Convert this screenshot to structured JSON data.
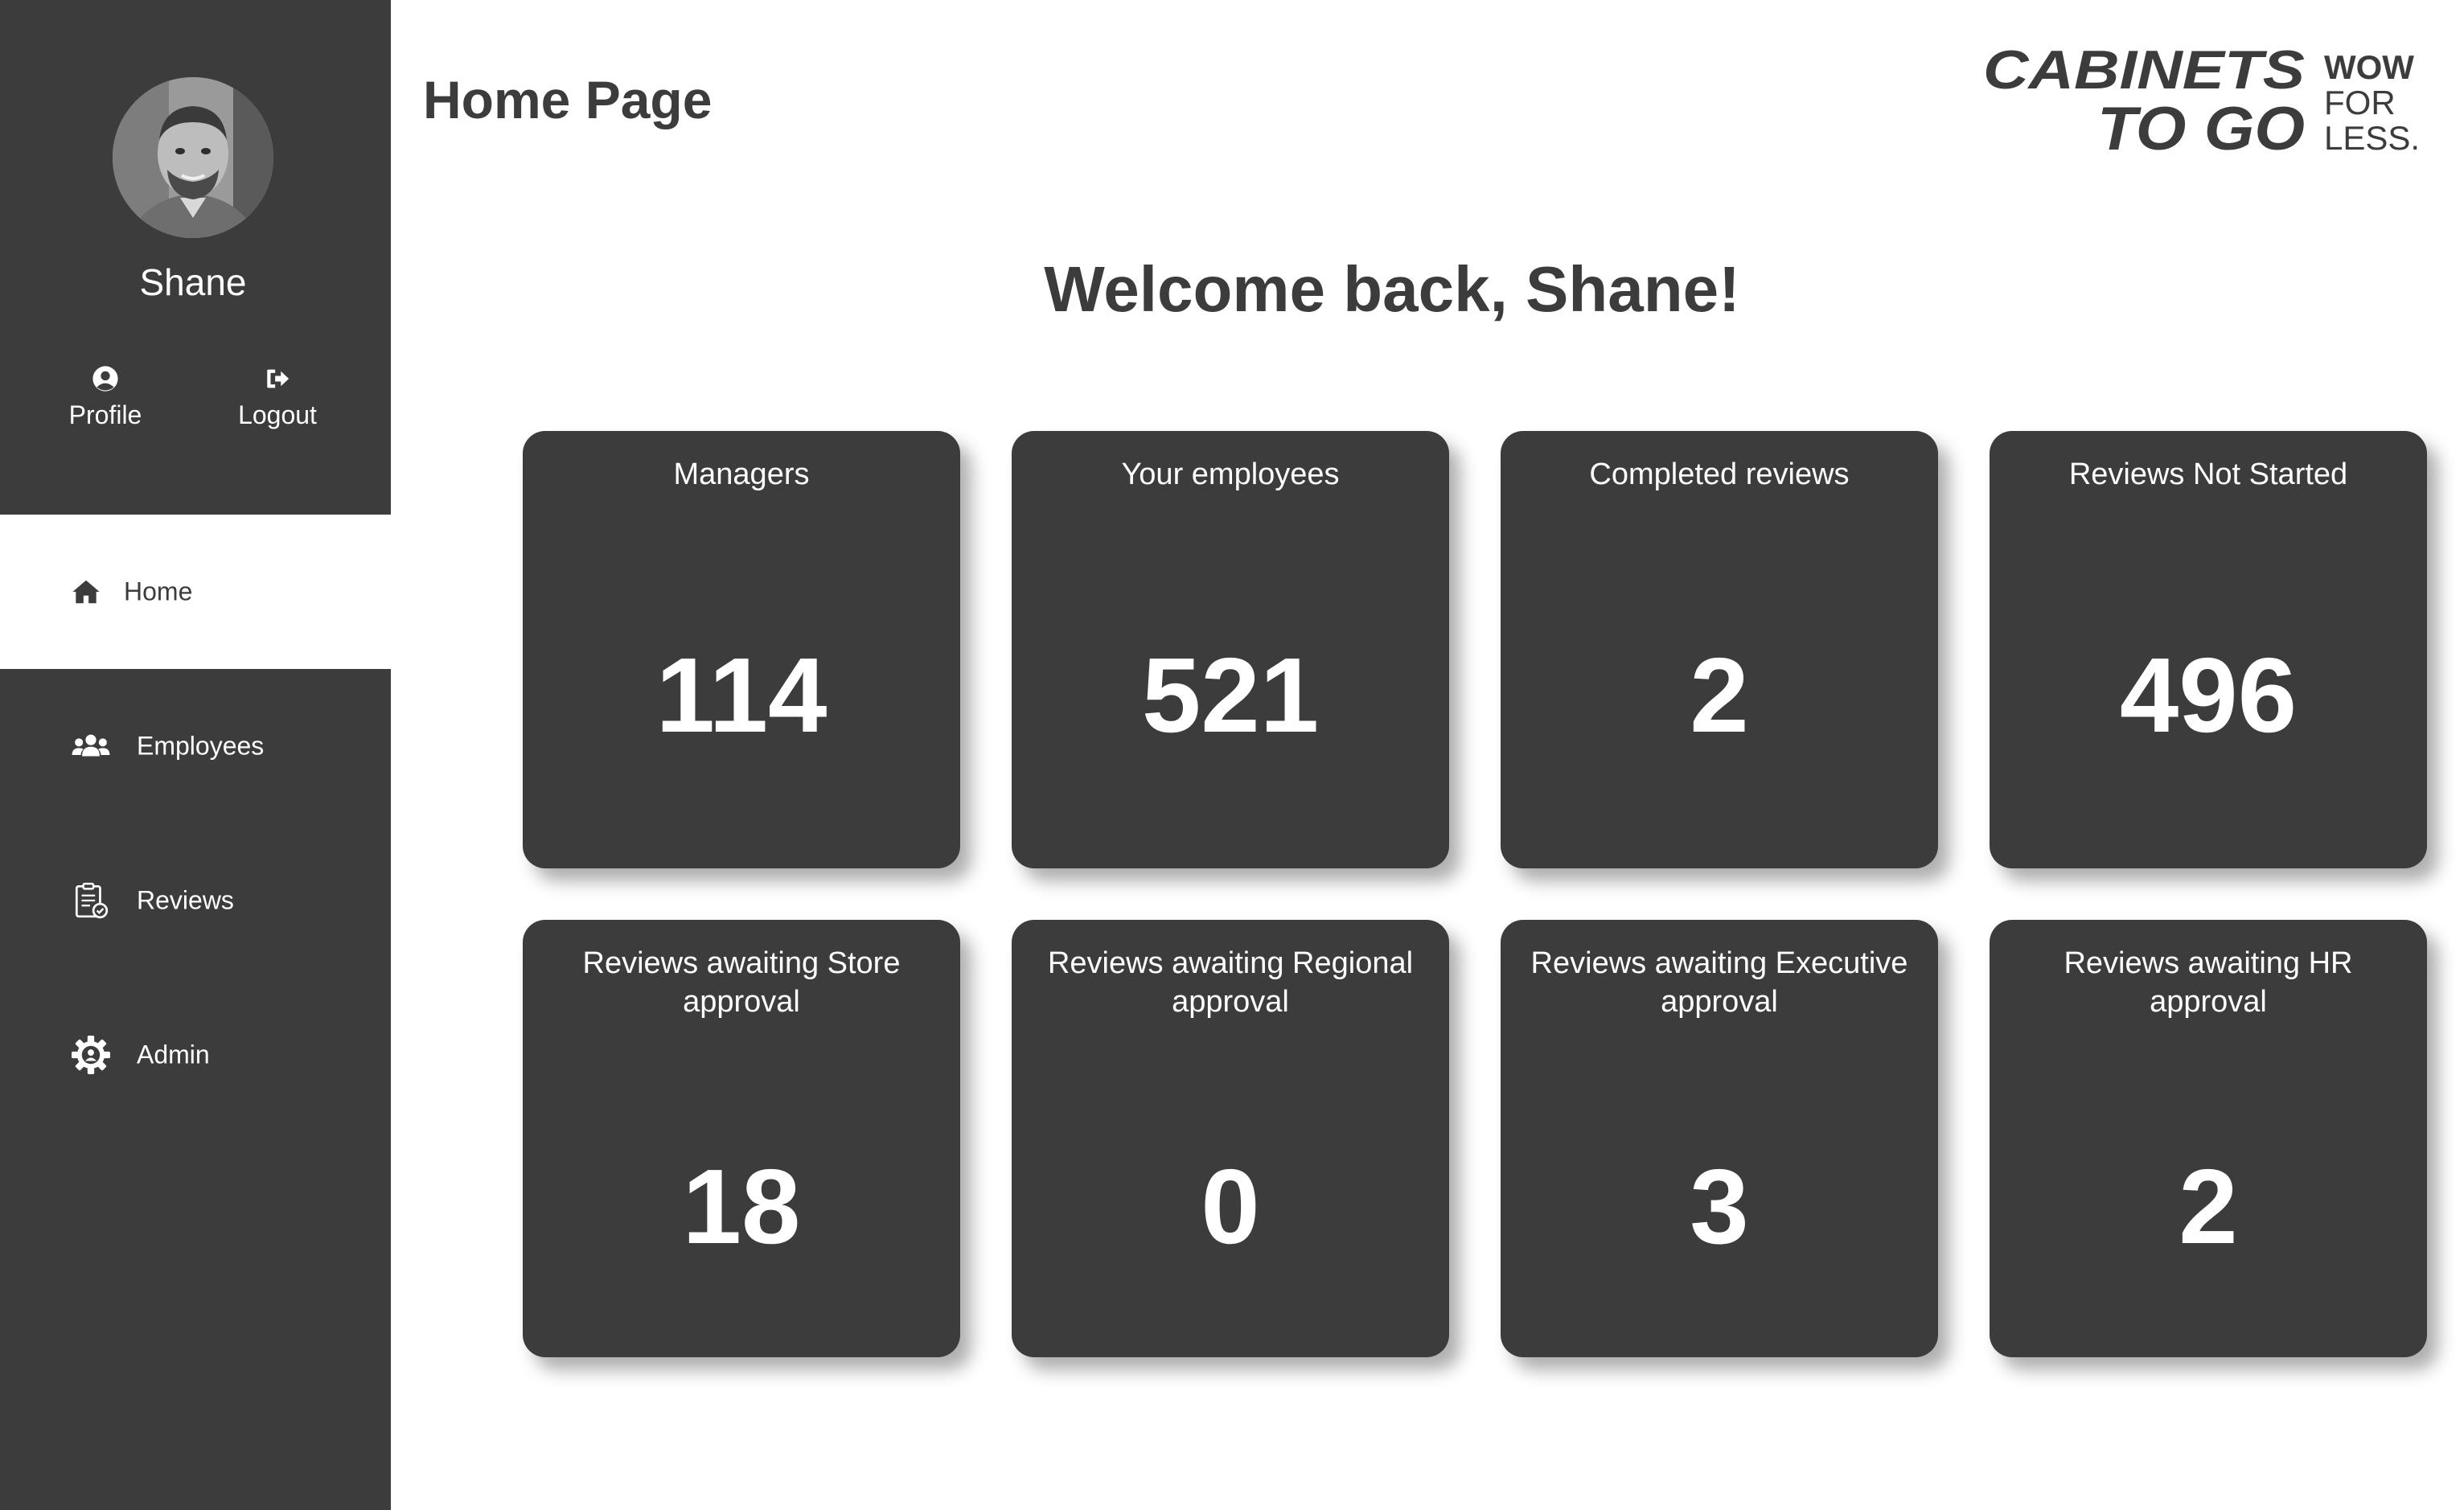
{
  "user": {
    "name": "Shane"
  },
  "sidebar": {
    "profile_label": "Profile",
    "logout_label": "Logout",
    "items": [
      {
        "label": "Home",
        "icon": "home-icon",
        "active": true
      },
      {
        "label": "Employees",
        "icon": "users-icon",
        "active": false
      },
      {
        "label": "Reviews",
        "icon": "clipboard-icon",
        "active": false
      },
      {
        "label": "Admin",
        "icon": "gear-icon",
        "active": false
      }
    ]
  },
  "header": {
    "title": "Home Page",
    "logo": {
      "line1": "CABINETS",
      "line2": "TO GO",
      "tag1": "WOW",
      "tag2": "FOR",
      "tag3": "LESS."
    }
  },
  "welcome": "Welcome back, Shane!",
  "stats": [
    {
      "label": "Managers",
      "value": "114"
    },
    {
      "label": "Your employees",
      "value": "521"
    },
    {
      "label": "Completed reviews",
      "value": "2"
    },
    {
      "label": "Reviews Not Started",
      "value": "496"
    },
    {
      "label": "Reviews awaiting Store approval",
      "value": "18"
    },
    {
      "label": "Reviews awaiting Regional approval",
      "value": "0"
    },
    {
      "label": "Reviews awaiting Executive approval",
      "value": "3"
    },
    {
      "label": "Reviews awaiting HR approval",
      "value": "2"
    }
  ],
  "colors": {
    "sidebar_bg": "#3c3c3c",
    "card_bg": "#3c3c3c",
    "text_dark": "#3c3c3c",
    "text_light": "#ffffff",
    "page_bg": "#ffffff"
  }
}
